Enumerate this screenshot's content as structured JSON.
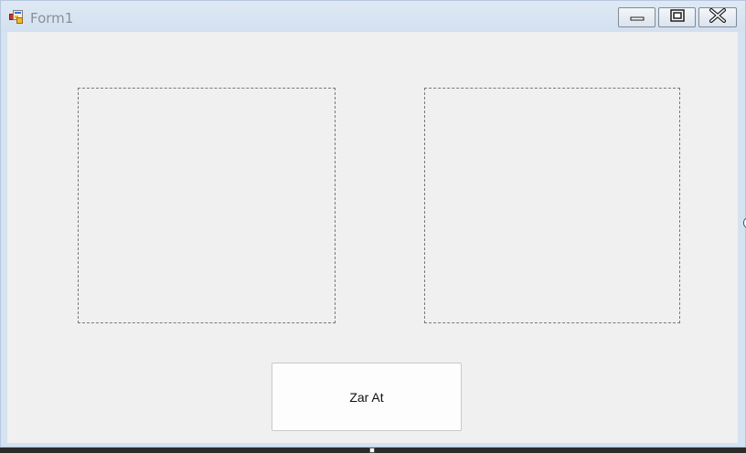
{
  "window": {
    "title": "Form1",
    "icons": {
      "app": "winforms-app-icon",
      "minimize": "minimize-icon",
      "maximize": "maximize-icon",
      "close": "close-icon"
    }
  },
  "form": {
    "picture_boxes": [
      "left-picture-box",
      "right-picture-box"
    ],
    "roll_button_label": "Zar At"
  },
  "colors": {
    "titlebar": "#d3e0ef",
    "client_background": "#f0f0f0",
    "dashed_border": "#7a7a7a"
  }
}
